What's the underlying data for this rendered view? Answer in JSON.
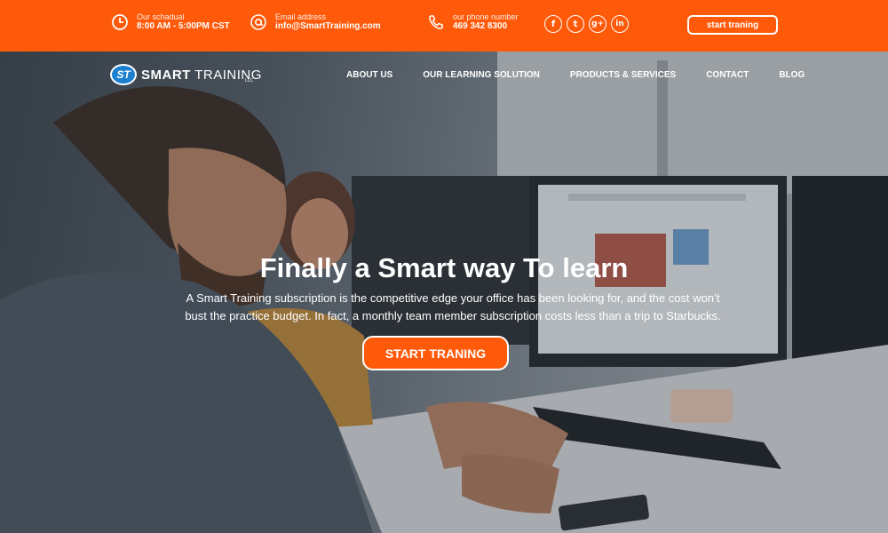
{
  "topbar": {
    "schedule": {
      "label": "Our schadual",
      "value": "8:00 AM - 5:00PM CST"
    },
    "email": {
      "label": "Email address",
      "value": "info@SmartTraining.com"
    },
    "phone": {
      "label": "our phone number",
      "value": "469 342 8300"
    },
    "socials": [
      {
        "icon": "facebook-icon",
        "glyph": "f"
      },
      {
        "icon": "twitter-icon",
        "glyph": "t"
      },
      {
        "icon": "google-plus-icon",
        "glyph": "g+"
      },
      {
        "icon": "linkedin-icon",
        "glyph": "in"
      }
    ],
    "cta_label": "start traning"
  },
  "nav": {
    "logo_mark": "ST",
    "logo_bold": "SMART",
    "logo_light": " TRAINING",
    "logo_sub": "LLC",
    "items": [
      "ABOUT US",
      "OUR LEARNING SOLUTION",
      "PRODUCTS & SERVICES",
      "CONTACT",
      "BLOG"
    ]
  },
  "hero": {
    "title": "Finally a Smart way To learn",
    "subtitle": "A Smart Training subscription is the competitive edge your office has been looking for, and the cost won’t bust the practice budget. In fact, a monthly team member subscription costs less than a trip to Starbucks.",
    "cta_label": "START TRANING"
  },
  "colors": {
    "accent": "#ff5a0a",
    "text": "#ffffff"
  }
}
